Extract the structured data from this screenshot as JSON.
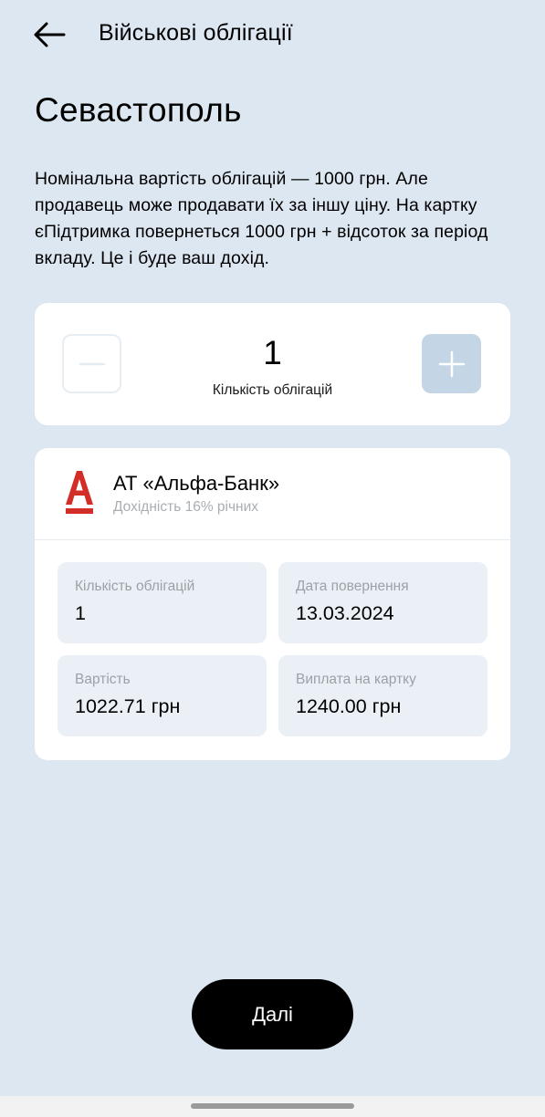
{
  "header": {
    "title": "Військові облігації",
    "back_icon": "arrow-left-icon"
  },
  "page": {
    "title": "Севастополь",
    "description": "Номінальна вартість облігацій — 1000 грн. Але продавець може продавати їх за іншу ціну. На картку єПідтримка повернеться 1000 грн + відсоток за період вкладу. Це і буде ваш дохід."
  },
  "quantity": {
    "value": "1",
    "label": "Кількість облігацій",
    "minus_icon": "minus-icon",
    "plus_icon": "plus-icon",
    "minus_enabled": false,
    "plus_enabled": false
  },
  "bank": {
    "name": "АТ «Альфа-Банк»",
    "yield": "Дохідність 16% річних",
    "logo_icon": "alfa-bank-logo-icon",
    "logo_color": "#d32d27"
  },
  "details": [
    {
      "label": "Кількість облігацій",
      "value": "1"
    },
    {
      "label": "Дата повернення",
      "value": "13.03.2024"
    },
    {
      "label": "Вартість",
      "value": "1022.71 грн"
    },
    {
      "label": "Виплата на картку",
      "value": "1240.00 грн"
    }
  ],
  "footer": {
    "next_label": "Далі"
  },
  "colors": {
    "background": "#dde7f1",
    "card": "#ffffff",
    "tile": "#eaf0f5",
    "plus_button_disabled": "#c4d6e6",
    "primary_button": "#000000"
  }
}
